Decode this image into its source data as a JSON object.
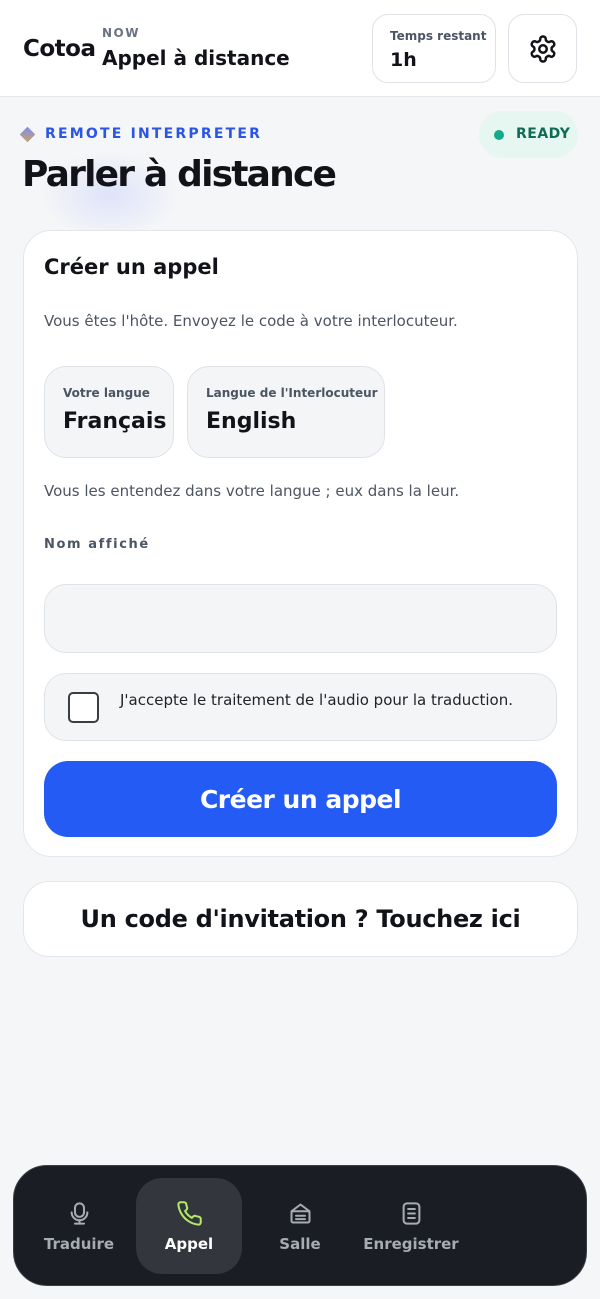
{
  "header": {
    "brand": "Cotoa",
    "now_label": "NOW",
    "now_value": "Appel à distance",
    "time_label": "Temps restant",
    "time_value": "1h",
    "settings_icon": "gear-icon"
  },
  "intro": {
    "eyebrow": "REMOTE INTERPRETER",
    "title": "Parler à distance",
    "status": "READY",
    "status_color": "#14a98a"
  },
  "card": {
    "title": "Créer un appel",
    "description": "Vous êtes l'hôte. Envoyez le code à votre interlocuteur.",
    "my_language_label": "Votre langue",
    "my_language_value": "Français",
    "peer_language_label": "Langue de l'Interlocuteur",
    "peer_language_value": "English",
    "language_hint": "Vous les entendez dans votre langue ; eux dans la leur.",
    "name_label": "Nom affiché",
    "name_value": "",
    "consent_text": "J'accepte le traitement de l'audio pour la traduction.",
    "consent_checked": false,
    "create_button": "Créer un appel"
  },
  "invite": {
    "label": "Un code d'invitation ? Touchez ici"
  },
  "nav": {
    "items": [
      {
        "label": "Traduire",
        "icon": "microphone-icon",
        "active": false
      },
      {
        "label": "Appel",
        "icon": "phone-icon",
        "active": true
      },
      {
        "label": "Salle",
        "icon": "room-icon",
        "active": false
      },
      {
        "label": "Enregistrer",
        "icon": "document-icon",
        "active": false
      }
    ]
  },
  "colors": {
    "accent": "#245bf5",
    "active_icon": "#b5e86a",
    "nav_background": "#1b1d24"
  }
}
